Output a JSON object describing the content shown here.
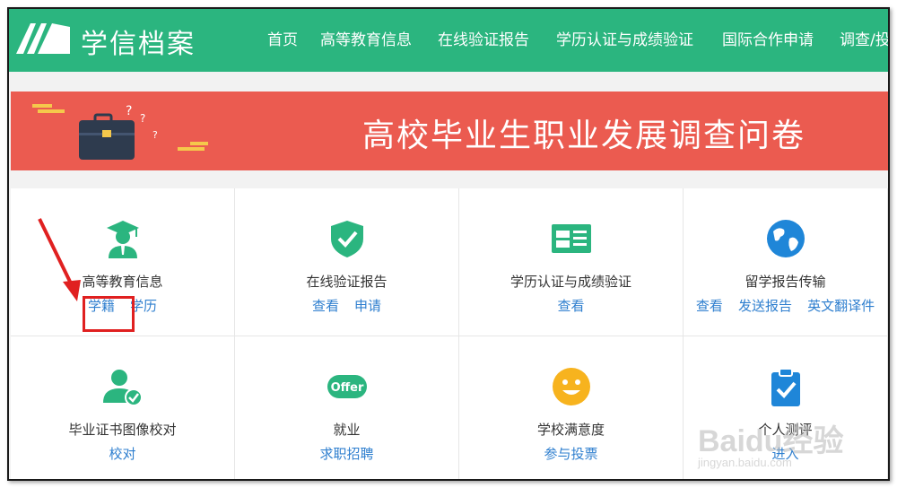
{
  "header": {
    "logo_text": "学信档案",
    "nav": [
      "首页",
      "高等教育信息",
      "在线验证报告",
      "学历认证与成绩验证",
      "国际合作申请",
      "调查/投"
    ]
  },
  "banner": {
    "title": "高校毕业生职业发展调查问卷"
  },
  "services": [
    {
      "title": "高等教育信息",
      "icon": "graduate-icon",
      "links": [
        "学籍",
        "学历"
      ]
    },
    {
      "title": "在线验证报告",
      "icon": "shield-check-icon",
      "links": [
        "查看",
        "申请"
      ]
    },
    {
      "title": "学历认证与成绩验证",
      "icon": "id-card-icon",
      "links": [
        "查看"
      ]
    },
    {
      "title": "留学报告传输",
      "icon": "globe-icon",
      "links": [
        "查看",
        "发送报告",
        "英文翻译件"
      ]
    },
    {
      "title": "毕业证书图像校对",
      "icon": "user-check-icon",
      "links": [
        "校对"
      ]
    },
    {
      "title": "就业",
      "icon": "offer-icon",
      "icon_text": "Offer",
      "links": [
        "求职招聘"
      ]
    },
    {
      "title": "学校满意度",
      "icon": "smile-icon",
      "links": [
        "参与投票"
      ]
    },
    {
      "title": "个人测评",
      "icon": "clipboard-check-icon",
      "links": [
        "进入"
      ]
    }
  ],
  "watermark": {
    "text": "Baidu经验",
    "sub": "jingyan.baidu.com"
  },
  "colors": {
    "brand_green": "#2bb57f",
    "banner_red": "#eb5b50",
    "link_blue": "#2f7fcf",
    "highlight_red": "#e02020"
  }
}
